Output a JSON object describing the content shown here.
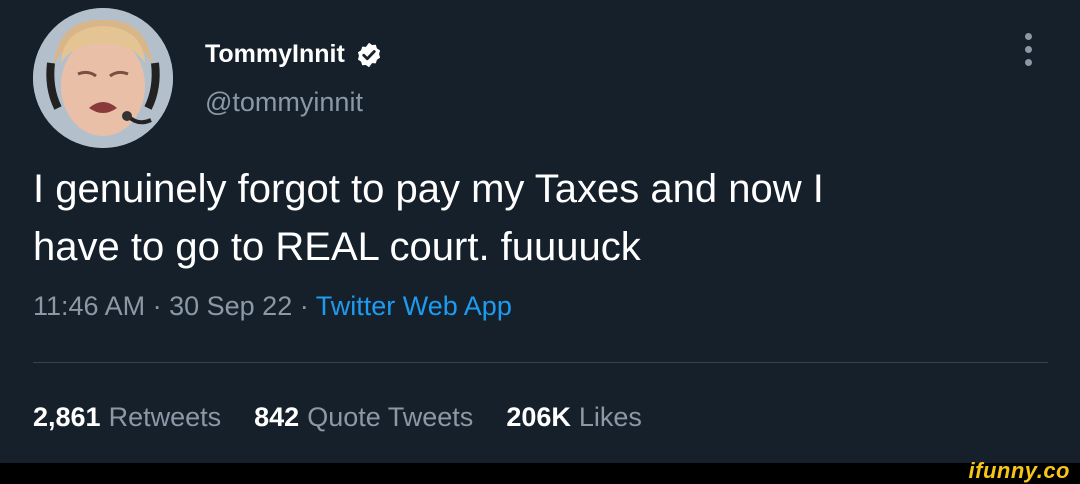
{
  "author": {
    "display_name": "TommyInnit",
    "handle": "@tommyinnit",
    "avatar_icon": "avatar-photo",
    "verified_icon": "verified-badge-icon"
  },
  "tweet": {
    "text_line1": "I genuinely forgot to pay my Taxes and now I",
    "text_line2": "have to go to REAL court. fuuuuck",
    "time": "11:46 AM",
    "date": "30 Sep 22",
    "separator": "·",
    "source": "Twitter Web App"
  },
  "stats": {
    "retweets_count": "2,861",
    "retweets_label": "Retweets",
    "quotes_count": "842",
    "quotes_label": "Quote Tweets",
    "likes_count": "206K",
    "likes_label": "Likes"
  },
  "watermark": "ifunny.co",
  "colors": {
    "background": "#15202b",
    "text": "#ffffff",
    "secondary": "#8b98a5",
    "link": "#1d9bf0",
    "verified": "#ffffff",
    "watermark": "#f5c518"
  }
}
